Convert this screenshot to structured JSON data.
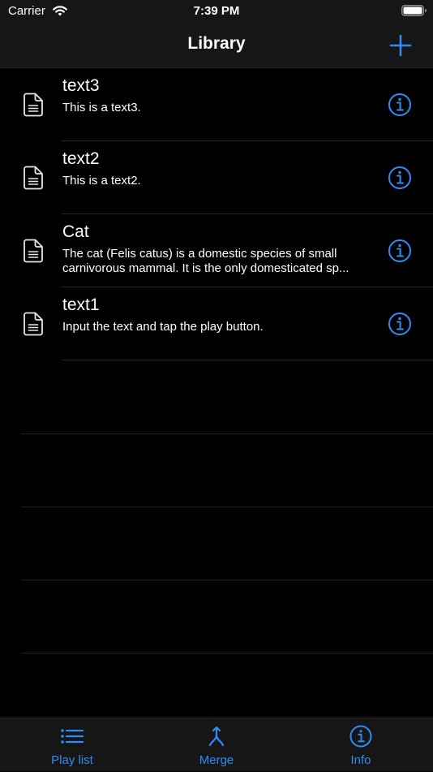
{
  "status_bar": {
    "carrier": "Carrier",
    "time": "7:39 PM",
    "wifi_icon": "wifi-icon",
    "battery_icon": "battery-full-icon"
  },
  "nav": {
    "title": "Library",
    "add_icon": "plus-icon"
  },
  "items": [
    {
      "title": "text3",
      "subtitle": "This is a text3.",
      "icon": "document-icon",
      "action_icon": "info-circle-icon"
    },
    {
      "title": "text2",
      "subtitle": "This is a text2.",
      "icon": "document-icon",
      "action_icon": "info-circle-icon"
    },
    {
      "title": "Cat",
      "subtitle": "The cat (Felis catus) is a domestic species of small carnivorous mammal. It is the only domesticated sp...",
      "icon": "document-icon",
      "action_icon": "info-circle-icon"
    },
    {
      "title": "text1",
      "subtitle": "Input the text and tap the play button.",
      "icon": "document-icon",
      "action_icon": "info-circle-icon"
    }
  ],
  "tabs": [
    {
      "label": "Play list",
      "icon": "list-icon"
    },
    {
      "label": "Merge",
      "icon": "merge-icon"
    },
    {
      "label": "Info",
      "icon": "info-circle-icon"
    }
  ],
  "colors": {
    "accent": "#2f8cf6",
    "background": "#000000",
    "bar_background": "#161616",
    "separator": "#262626",
    "text": "#ffffff"
  }
}
